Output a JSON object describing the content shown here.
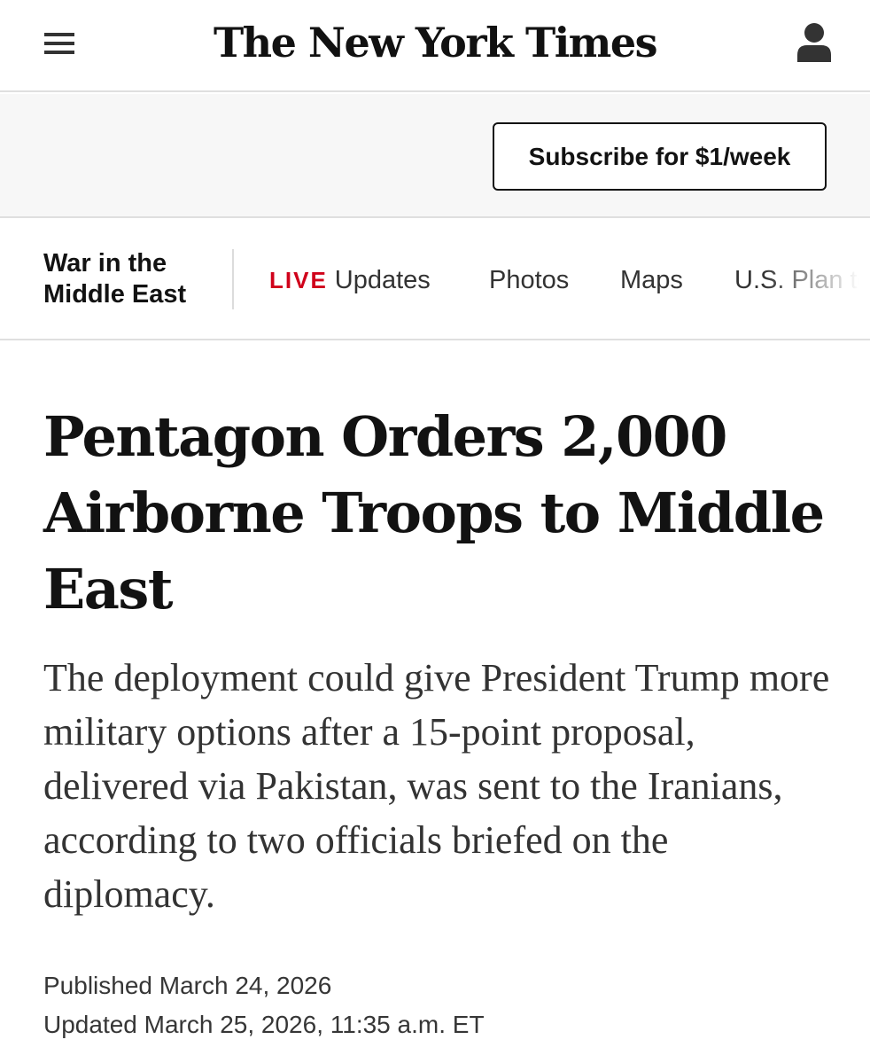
{
  "header": {
    "masthead": "The New York Times",
    "menu_icon": "hamburger-menu-icon",
    "account_icon": "user-account-icon"
  },
  "promo": {
    "subscribe_label": "Subscribe for $1/week"
  },
  "section_nav": {
    "title": "War in the Middle East",
    "live_label": "LIVE",
    "items": [
      {
        "label": "Updates"
      },
      {
        "label": "Photos"
      },
      {
        "label": "Maps"
      },
      {
        "label": "U.S. Plan to"
      }
    ]
  },
  "article": {
    "headline": "Pentagon Orders 2,000 Airborne Troops to Middle East",
    "summary": "The deployment could give President Trump more military options after a 15-point proposal, delivered via Pakistan, was sent to the Iranians, according to two officials briefed on the diplomacy.",
    "published": "Published March 24, 2026",
    "updated": "Updated March 25, 2026, 11:35 a.m. ET"
  },
  "colors": {
    "live_red": "#d0021b",
    "text_primary": "#121212",
    "promo_bg": "#f7f7f7"
  }
}
